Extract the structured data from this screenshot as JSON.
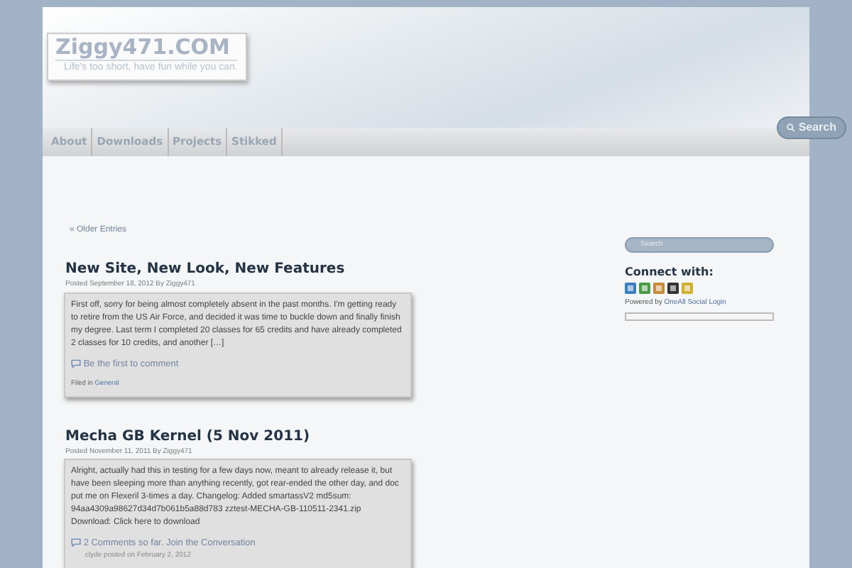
{
  "site": {
    "title": "Ziggy471.COM",
    "tagline": "Life's too short, have fun while you can."
  },
  "nav": [
    {
      "label": "About"
    },
    {
      "label": "Downloads"
    },
    {
      "label": "Projects"
    },
    {
      "label": "Stikked"
    }
  ],
  "header_search": {
    "label": "Search"
  },
  "older_entries": "« Older Entries",
  "posts": [
    {
      "title": "New Site, New Look, New Features",
      "meta": "Posted September 18, 2012 By Ziggy471",
      "excerpt": "First off, sorry for being almost completely absent in the past months. I'm getting ready to retire from the US Air Force, and decided it was time to buckle down and finally finish my degree.  Last term I completed 20 classes for 65 credits and have already completed 2 classes for 10 credits, and another […]",
      "comments": "Be the first to comment",
      "filed_label": "Filed in",
      "category": "General"
    },
    {
      "title": "Mecha GB Kernel (5 Nov 2011)",
      "meta": "Posted November 11, 2011 By Ziggy471",
      "excerpt": "Alright, actually had this in testing for a few days now, meant to already release it, but have been sleeping more than anything recently, got rear-ended the other day, and doc put me on Flexeril 3-times a day.  Changelog: Added smartassV2 md5sum: 94aa4309a98627d34d7b061b5a88d783  zztest-MECHA-GB-110511-2341.zip Download: Click here to download",
      "comments": "2 Comments so far. Join the Conversation",
      "latest_comment": "clyde posted on February 2, 2012"
    }
  ],
  "sidebar": {
    "search_placeholder": "Search",
    "connect_title": "Connect with:",
    "powered_label": "Powered by",
    "powered_link": "OneAll Social Login"
  }
}
